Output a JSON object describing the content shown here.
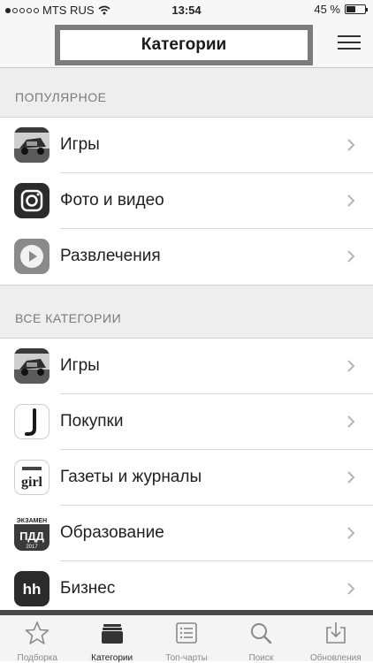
{
  "status_bar": {
    "carrier": "MTS RUS",
    "time": "13:54",
    "battery": "45 %"
  },
  "header": {
    "title": "Категории",
    "menu_icon": "list-menu-icon"
  },
  "sections": {
    "popular": {
      "header": "ПОПУЛЯРНОЕ",
      "items": [
        {
          "label": "Игры",
          "icon": "games-icon"
        },
        {
          "label": "Фото и видео",
          "icon": "camera-icon"
        },
        {
          "label": "Развлечения",
          "icon": "play-icon"
        }
      ]
    },
    "all": {
      "header": "ВСЕ КАТЕГОРИИ",
      "items": [
        {
          "label": "Игры",
          "icon": "games-icon"
        },
        {
          "label": "Покупки",
          "icon": "shopping-icon"
        },
        {
          "label": "Газеты и журналы",
          "icon": "newspaper-icon",
          "icon_text": "girl"
        },
        {
          "label": "Образование",
          "icon": "education-icon",
          "icon_text_top": "ЭКЗАМЕН",
          "icon_text_mid": "ПДД",
          "icon_text_bottom": "2017"
        },
        {
          "label": "Бизнес",
          "icon": "business-icon",
          "icon_text": "hh"
        }
      ]
    }
  },
  "tab_bar": {
    "tabs": [
      {
        "label": "Подборка",
        "icon": "star-icon"
      },
      {
        "label": "Категории",
        "icon": "categories-icon",
        "active": true
      },
      {
        "label": "Топ-чарты",
        "icon": "top-charts-icon"
      },
      {
        "label": "Поиск",
        "icon": "search-icon"
      },
      {
        "label": "Обновления",
        "icon": "updates-icon"
      }
    ]
  }
}
